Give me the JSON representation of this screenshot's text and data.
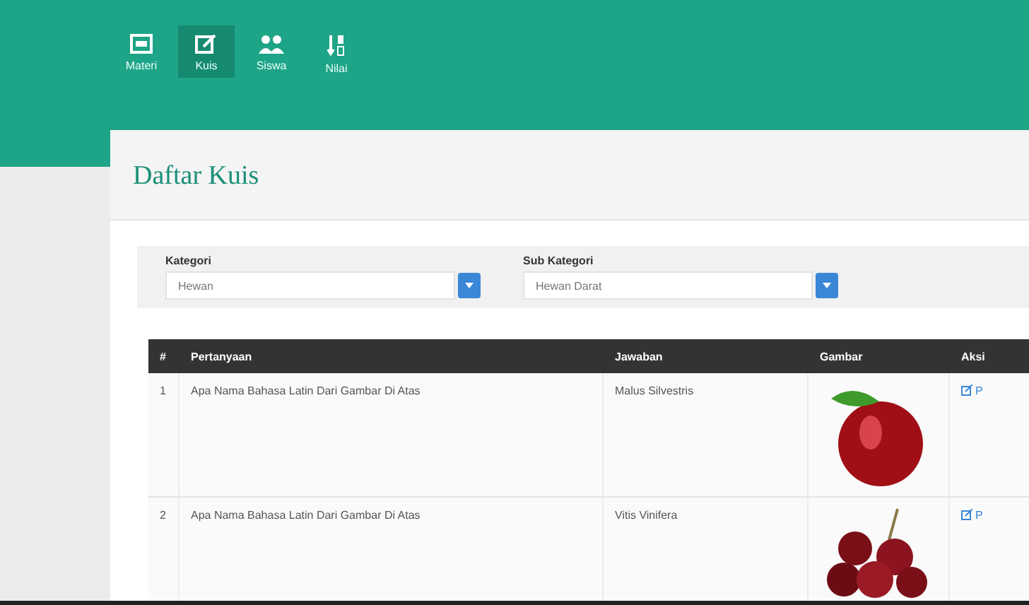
{
  "nav": [
    {
      "label": "Materi",
      "kind": "screen",
      "selected": false
    },
    {
      "label": "Kuis",
      "kind": "edit",
      "selected": true
    },
    {
      "label": "Siswa",
      "kind": "users",
      "selected": false
    },
    {
      "label": "Nilai",
      "kind": "sort",
      "selected": false
    }
  ],
  "title": "Daftar Kuis",
  "filters": [
    {
      "label": "Kategori",
      "value": "Hewan"
    },
    {
      "label": "Sub Kategori",
      "value": "Hewan Darat"
    }
  ],
  "table": {
    "columns": [
      "#",
      "Pertanyaan",
      "Jawaban",
      "Gambar",
      "Aksi"
    ],
    "rows": [
      {
        "no": "1",
        "question": "Apa Nama Bahasa Latin Dari Gambar Di Atas",
        "answer": "Malus Silvestris",
        "kind": "apple",
        "action": "P"
      },
      {
        "no": "2",
        "question": "Apa Nama Bahasa Latin Dari Gambar Di Atas",
        "answer": "Vitis Vinifera",
        "kind": "grapes",
        "action": "P"
      }
    ]
  }
}
